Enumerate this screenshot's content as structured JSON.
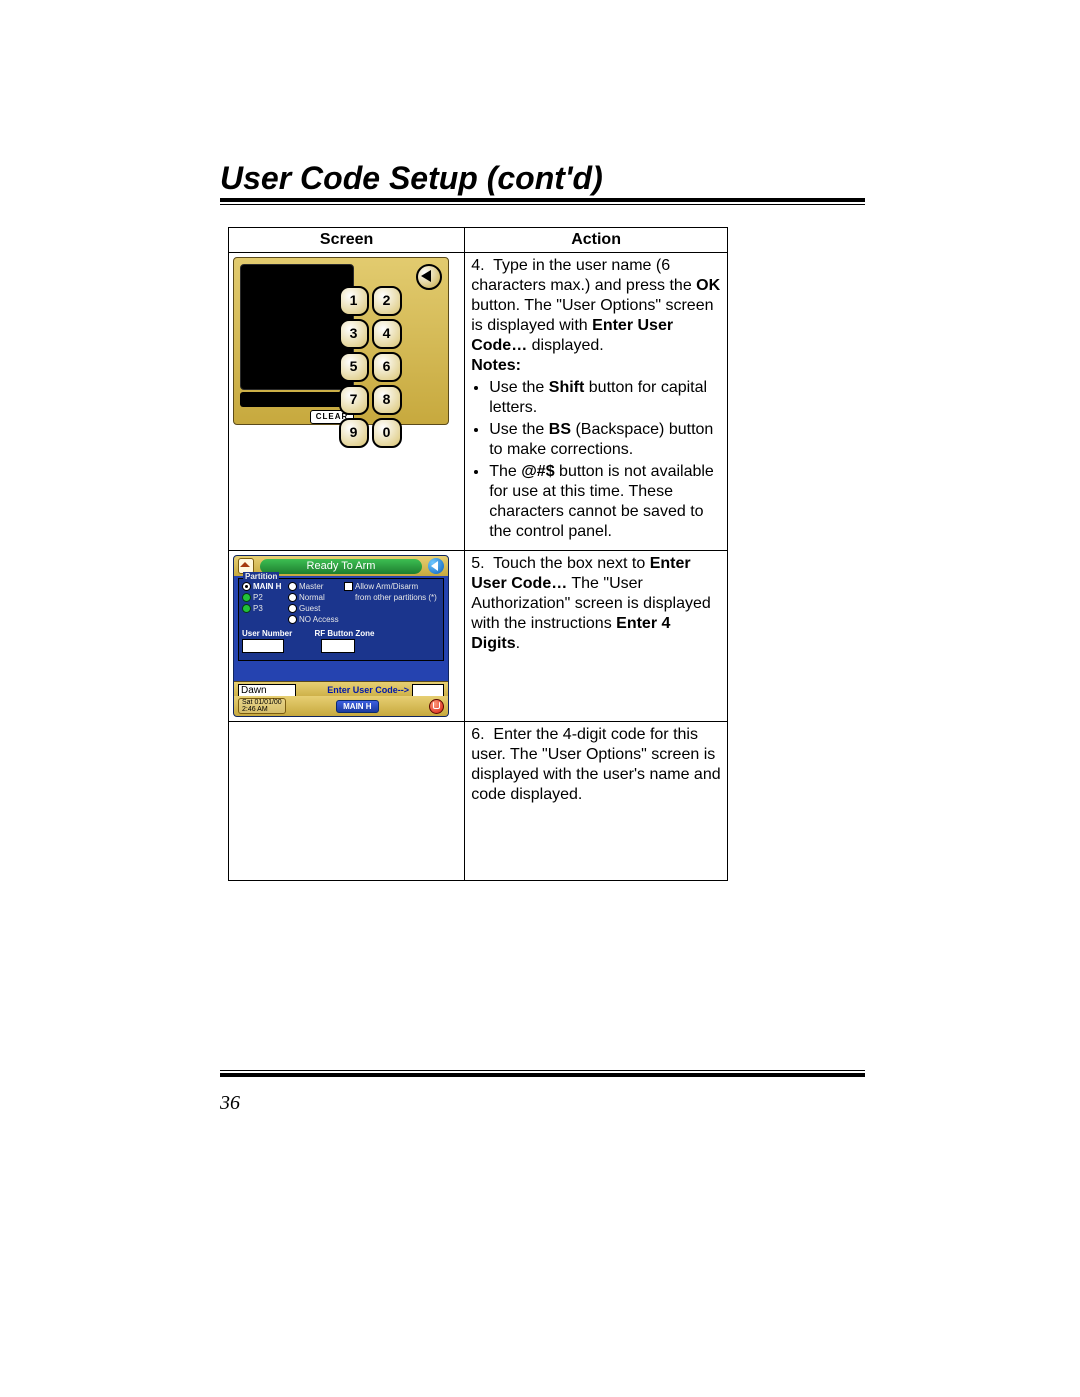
{
  "title": "User Code Setup (cont'd)",
  "page_number": "36",
  "table": {
    "headers": {
      "screen": "Screen",
      "action": "Action"
    }
  },
  "action4": {
    "lead_num": "4.",
    "p1a": "Type in the user name (6 characters max.) and press the ",
    "ok": "OK",
    "p1b": " button.  The \"User Options\" screen is displayed with ",
    "enter_user_code": "Enter User Code…",
    "p1c": " displayed.",
    "notes_label": "Notes:",
    "note1a": "Use the ",
    "note1_shift": "Shift",
    "note1b": " button for capital letters.",
    "note2a": "Use the ",
    "note2_bs": "BS",
    "note2b": " (Backspace) button to make corrections.",
    "note3a": "The ",
    "note3_sym": "@#$",
    "note3b": " button is not available for use at this time. These characters cannot be saved to the control panel."
  },
  "action5": {
    "lead_num": "5.",
    "p1a": "Touch the box next to ",
    "enter_user": "Enter User Code…",
    "p1b": "  The \"User Authorization\" screen is displayed with the instructions ",
    "enter4": "Enter 4 Digits",
    "p1c": "."
  },
  "action6": {
    "lead_num": "6.",
    "text": "Enter the 4-digit code for this user. The \"User Options\" screen is displayed with the user's name and code displayed."
  },
  "keypad": {
    "clear": "CLEAR",
    "keys": [
      "1",
      "2",
      "3",
      "4",
      "5",
      "6",
      "7",
      "8",
      "9",
      "0"
    ]
  },
  "ua": {
    "ready": "Ready To Arm",
    "partition_title": "Partition",
    "p_main": "MAIN H",
    "p_p2": "P2",
    "p_p3": "P3",
    "lvl_master": "Master",
    "lvl_normal": "Normal",
    "lvl_guest": "Guest",
    "lvl_noaccess": "NO Access",
    "allow": "Allow Arm/Disarm",
    "from_other": "from other partitions (*)",
    "user_number": "User Number",
    "rf_zone": "RF Button Zone",
    "name_value": "Dawn",
    "enter_code": "Enter User Code-->",
    "datetime_line1": "Sat 01/01/00",
    "datetime_line2": "2:46 AM",
    "main_btn": "MAIN H"
  }
}
